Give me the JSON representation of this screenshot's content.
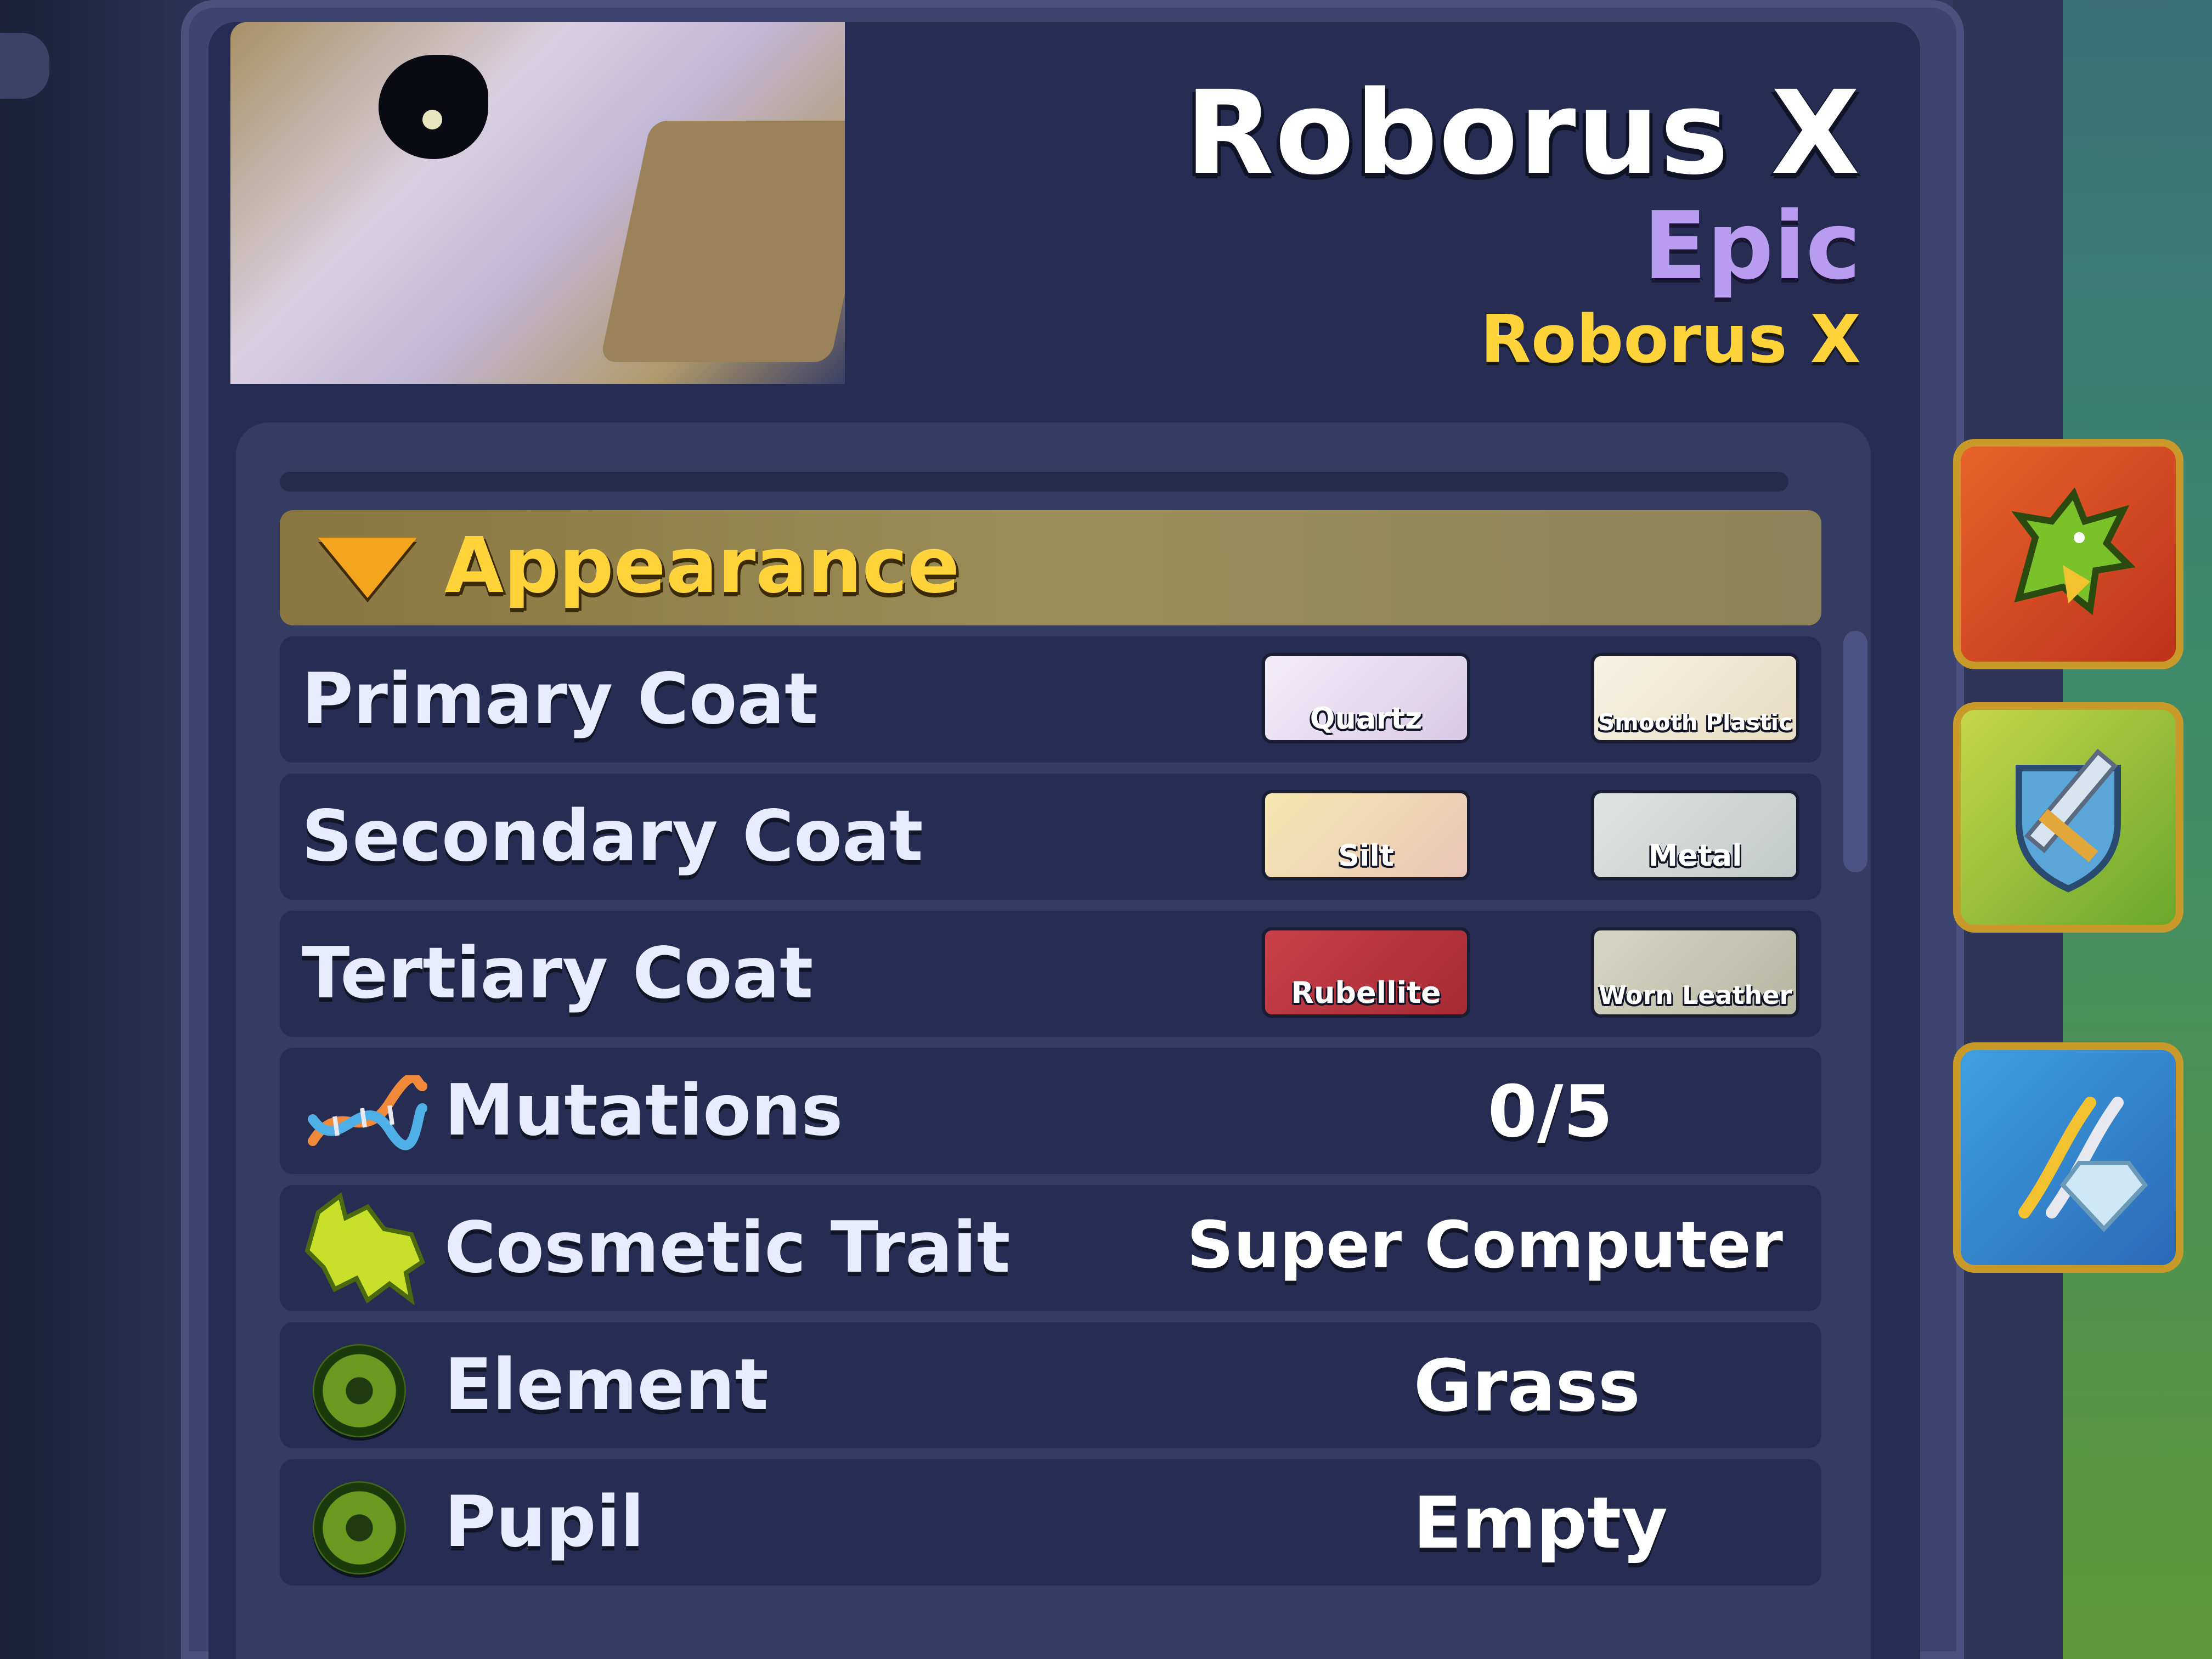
{
  "header": {
    "name": "Roborus X",
    "rarity": "Epic",
    "species": "Roborus X"
  },
  "section": {
    "title": "Appearance"
  },
  "coats": [
    {
      "label": "Primary Coat",
      "material_a": "Quartz",
      "material_b": "Smooth Plastic"
    },
    {
      "label": "Secondary Coat",
      "material_a": "Silt",
      "material_b": "Metal"
    },
    {
      "label": "Tertiary Coat",
      "material_a": "Rubellite",
      "material_b": "Worn Leather"
    }
  ],
  "stats": {
    "mutations": {
      "label": "Mutations",
      "value": "0/5"
    },
    "cosmetic_trait": {
      "label": "Cosmetic Trait",
      "value": "Super Computer"
    },
    "element": {
      "label": "Element",
      "value": "Grass"
    },
    "pupil": {
      "label": "Pupil",
      "value": "Empty"
    }
  },
  "side_tabs": [
    {
      "icon": "dragon-icon"
    },
    {
      "icon": "shield-sword-icon"
    },
    {
      "icon": "dna-gem-icon"
    }
  ],
  "colors": {
    "rarity_epic": "#b89cf0",
    "species_gold": "#ffd43b",
    "section_header": "#9b8d58",
    "swatch_quartz": "#e8dff0",
    "swatch_smooth_plastic": "#f1ead8",
    "swatch_silt": "#efdf9c",
    "swatch_metal": "#d2d7d6",
    "swatch_rubellite": "#b8323a",
    "swatch_worn_leather": "#c9c9b2"
  }
}
